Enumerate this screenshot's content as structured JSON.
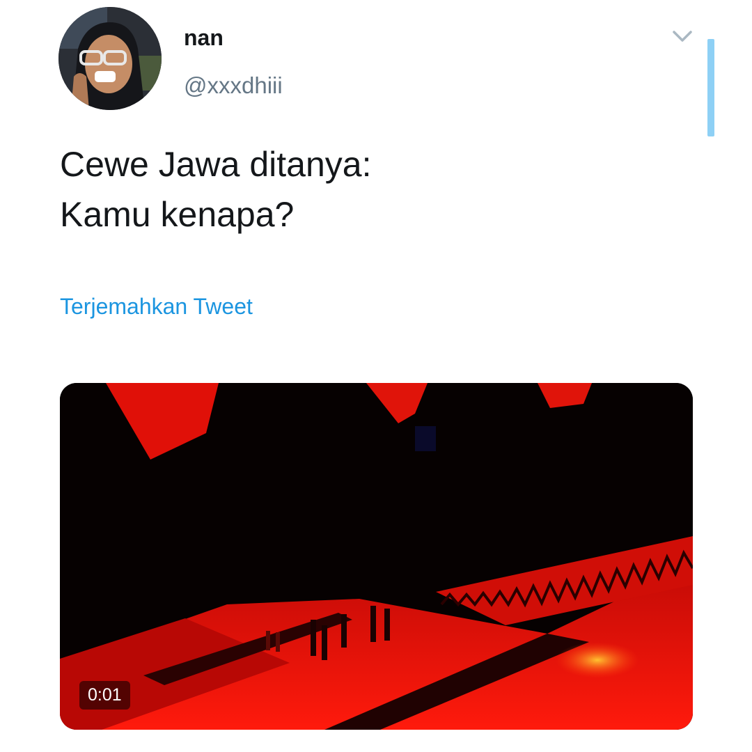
{
  "tweet": {
    "author_name": "nan",
    "author_handle": "@xxxdhiii",
    "text_lines": [
      "Cewe Jawa ditanya:",
      "Kamu kenapa?"
    ],
    "translate_label": "Terjemahkan Tweet"
  },
  "media": {
    "type": "video",
    "duration": "0:01"
  },
  "icons": {
    "menu": "chevron-down-icon"
  },
  "colors": {
    "text_primary": "#14171a",
    "text_secondary": "#657786",
    "link": "#1b95e0",
    "scrollbar": "#8ed0f5",
    "video_red": "#e01008"
  }
}
